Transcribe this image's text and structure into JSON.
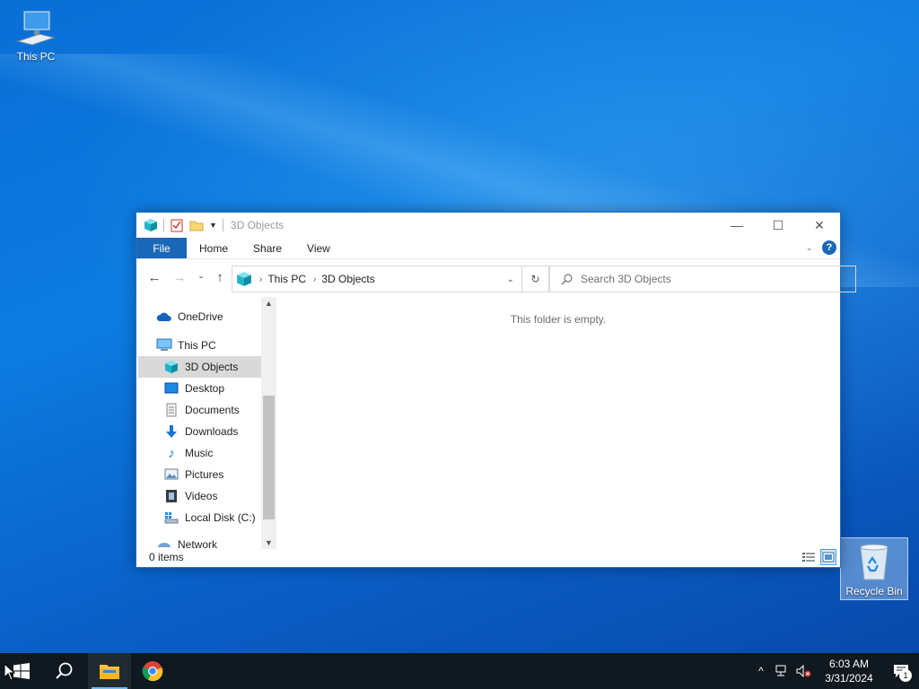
{
  "desktop": {
    "icons": [
      {
        "label": "This PC"
      },
      {
        "label": "Recycle Bin"
      }
    ]
  },
  "window": {
    "title": "3D Objects",
    "ribbon_tabs": [
      "File",
      "Home",
      "Share",
      "View"
    ],
    "help_label": "?",
    "breadcrumb": [
      "This PC",
      "3D Objects"
    ],
    "search_placeholder": "Search 3D Objects",
    "empty_message": "This folder is empty.",
    "status_text": "0 items",
    "nav_items": [
      {
        "label": "OneDrive",
        "icon": "onedrive-icon"
      },
      {
        "label": "This PC",
        "icon": "computer-icon"
      },
      {
        "label": "3D Objects",
        "icon": "3d-objects-icon",
        "selected": true
      },
      {
        "label": "Desktop",
        "icon": "desktop-folder-icon"
      },
      {
        "label": "Documents",
        "icon": "documents-icon"
      },
      {
        "label": "Downloads",
        "icon": "downloads-icon"
      },
      {
        "label": "Music",
        "icon": "music-icon"
      },
      {
        "label": "Pictures",
        "icon": "pictures-icon"
      },
      {
        "label": "Videos",
        "icon": "videos-icon"
      },
      {
        "label": "Local Disk (C:)",
        "icon": "local-disk-icon"
      },
      {
        "label": "Network",
        "icon": "network-icon"
      }
    ]
  },
  "taskbar": {
    "time": "6:03 AM",
    "date": "3/31/2024",
    "notification_count": "1"
  },
  "colors": {
    "accent": "#1a67b8",
    "taskbar": "#101820",
    "selection": "#d9d9d9"
  }
}
